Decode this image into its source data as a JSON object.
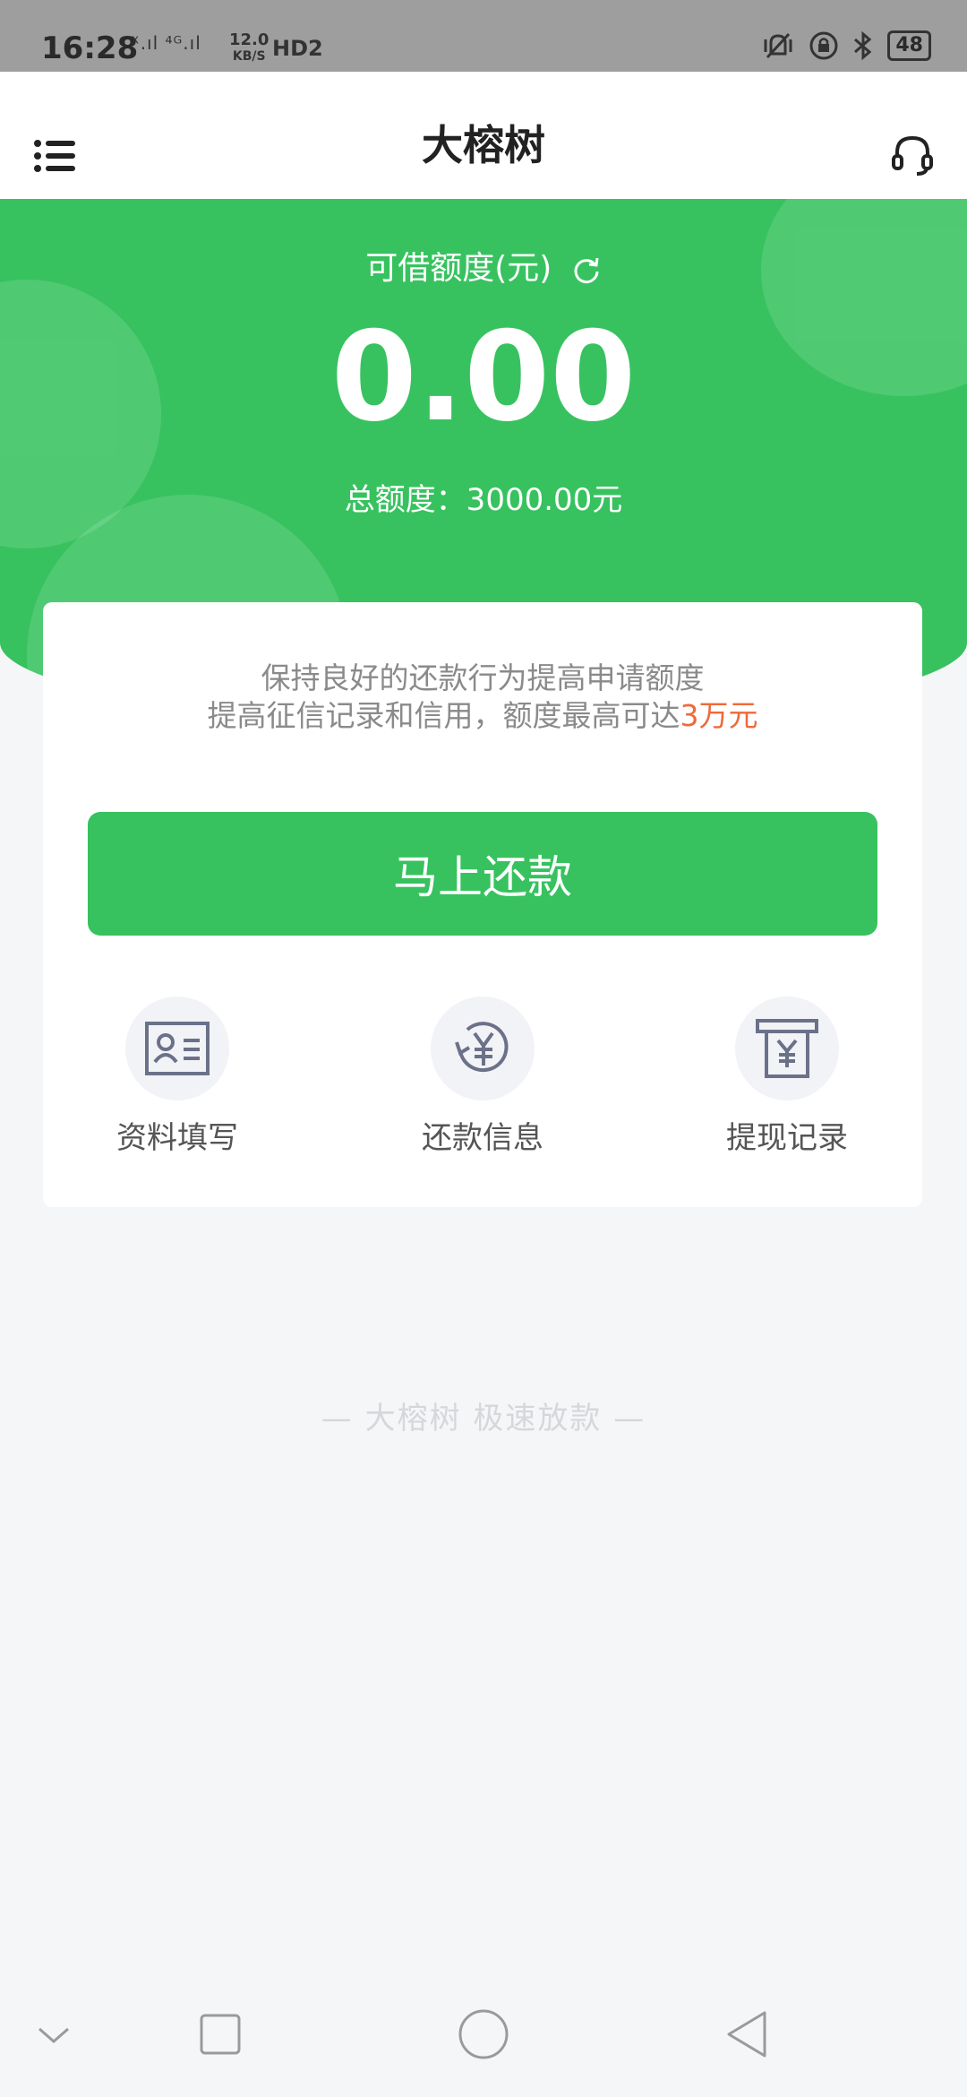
{
  "status_bar": {
    "time": "16:28",
    "signal_left": "ᕽ.ıl ⁴ᴳ.ıl",
    "net_speed_top": "12.0",
    "net_speed_bottom": "KB/S",
    "hd_label": "HD2",
    "battery": "48"
  },
  "header": {
    "title": "大榕树",
    "menu_icon": "menu-list-icon",
    "support_icon": "headset-icon"
  },
  "hero": {
    "quota_label": "可借额度(元)",
    "quota_amount": "0.00",
    "total_line": "总额度：3000.00元",
    "accent_color": "#37c25f"
  },
  "card": {
    "tip_line1": "保持良好的还款行为提高申请额度",
    "tip_line2_prefix": "提高征信记录和信用，额度最高可达",
    "tip_line2_highlight": "3万元",
    "repay_button": "马上还款",
    "actions": [
      {
        "label": "资料填写",
        "icon": "id-card-icon"
      },
      {
        "label": "还款信息",
        "icon": "yuan-refresh-icon"
      },
      {
        "label": "提现记录",
        "icon": "atm-withdraw-icon"
      }
    ]
  },
  "slogan": "— 大榕树  极速放款 —"
}
